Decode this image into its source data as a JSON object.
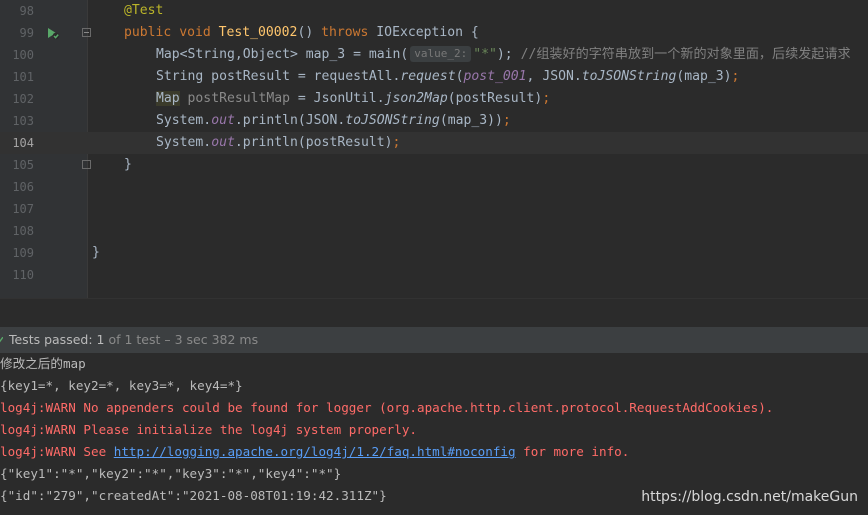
{
  "editor": {
    "lines": [
      {
        "num": "98"
      },
      {
        "num": "99"
      },
      {
        "num": "100"
      },
      {
        "num": "101"
      },
      {
        "num": "102"
      },
      {
        "num": "103"
      },
      {
        "num": "104"
      },
      {
        "num": "105"
      },
      {
        "num": "106"
      },
      {
        "num": "107"
      },
      {
        "num": "108"
      },
      {
        "num": "109"
      },
      {
        "num": "110"
      }
    ],
    "code": {
      "annotation": "@Test",
      "sig_public": "public ",
      "sig_void": "void ",
      "sig_method": "Test_00002",
      "sig_paren": "() ",
      "sig_throws": "throws ",
      "sig_exception": "IOException {",
      "l100_a": "Map<String,Object> map_3 = main(",
      "l100_hint": "value_2:",
      "l100_str": "\"*\"",
      "l100_b": "); ",
      "l100_comment": "//组装好的字符串放到一个新的对象里面，后续发起请求",
      "l101_a": "String postResult = requestAll.",
      "l101_fn": "request",
      "l101_b": "(",
      "l101_field": "post_001",
      "l101_c": ", JSON.",
      "l101_fn2": "toJSONString",
      "l101_d": "(map_3)",
      "l101_semi": ";",
      "l102_type": "Map",
      "l102_var": " postResultMap",
      "l102_a": " = JsonUtil.",
      "l102_fn": "json2Map",
      "l102_b": "(postResult)",
      "l102_semi": ";",
      "l103_a": "System.",
      "l103_out": "out",
      "l103_b": ".println(JSON.",
      "l103_fn": "toJSONString",
      "l103_c": "(map_3))",
      "l103_semi": ";",
      "l104_a": "System.",
      "l104_out": "out",
      "l104_b": ".println(postResult)",
      "l104_semi": ";",
      "l105": "}",
      "l109": "}"
    }
  },
  "test_status": {
    "label": "Tests passed: ",
    "count": "1",
    "detail": " of 1 test – 3 sec 382 ms"
  },
  "console": {
    "lines": [
      "修改之后的map",
      "{key1=*, key2=*, key3=*, key4=*}",
      "log4j:WARN No appenders could be found for logger (org.apache.http.client.protocol.RequestAddCookies).",
      "log4j:WARN Please initialize the log4j system properly.",
      "{\"key1\":\"*\",\"key2\":\"*\",\"key3\":\"*\",\"key4\":\"*\"}",
      "{\"id\":\"279\",\"createdAt\":\"2021-08-08T01:19:42.311Z\"}"
    ],
    "warn_see_prefix": "log4j:WARN See ",
    "warn_see_link": "http://logging.apache.org/log4j/1.2/faq.html#noconfig",
    "warn_see_suffix": " for more info."
  },
  "watermark": "https://blog.csdn.net/makeGun",
  "colors": {
    "background": "#2b2b2b",
    "keyword": "#cc7832",
    "method": "#ffc66d",
    "string": "#6a8759",
    "field": "#9876aa",
    "annotation": "#bbb529",
    "warn_text": "#ff6b68",
    "link": "#589df6"
  },
  "icons": {
    "run_gutter": "run-test-icon",
    "fold": "fold-icon",
    "passed": "test-passed-icon"
  }
}
